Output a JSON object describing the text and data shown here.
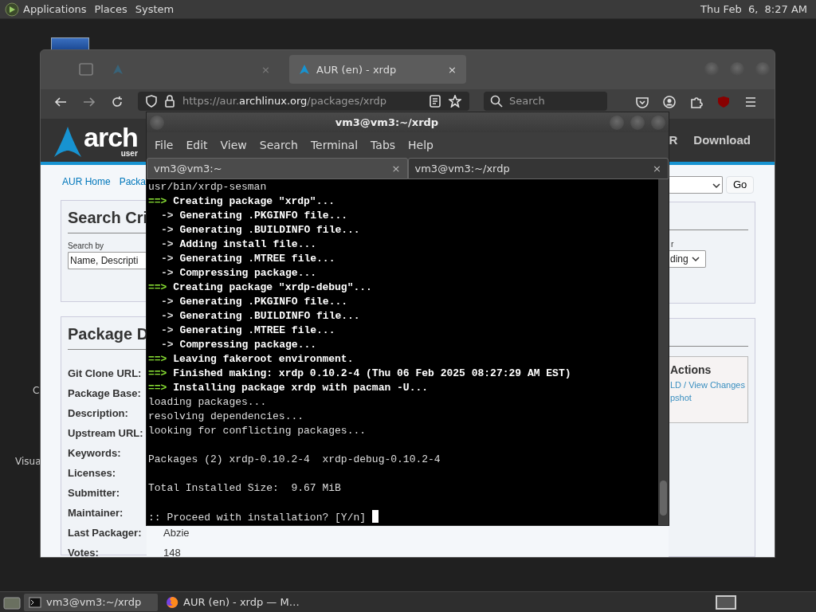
{
  "top_panel": {
    "menus": [
      "Applications",
      "Places",
      "System"
    ],
    "clock": "Thu Feb  6,  8:27 AM"
  },
  "desktop_icons": [
    {
      "label": "C"
    },
    {
      "label": "Visua"
    }
  ],
  "browser": {
    "tabs": [
      {
        "selected": false,
        "close": "×"
      },
      {
        "title": "AUR (en) - xrdp",
        "selected": true,
        "close": "×"
      }
    ],
    "url_parts": [
      "https://aur.",
      "archlinux.org",
      "/packages/xrdp"
    ],
    "search_placeholder": "Search",
    "site": {
      "logo": "arch",
      "logo_sub": "user",
      "nav": [
        "R",
        "Download"
      ],
      "breadcrumb": [
        "AUR Home",
        "Packa"
      ],
      "search_box": {
        "title": "Search Cri",
        "search_by_label": "Search by",
        "search_by_value": "Name, Descripti",
        "order_label": "r",
        "order_value": "ding",
        "go": "Go"
      },
      "details": {
        "title": "Package D",
        "fields": [
          {
            "label": "Git Clone URL:"
          },
          {
            "label": "Package Base:"
          },
          {
            "label": "Description:"
          },
          {
            "label": "Upstream URL:"
          },
          {
            "label": "Keywords:"
          },
          {
            "label": "Licenses:"
          },
          {
            "label": "Submitter:"
          },
          {
            "label": "Maintainer:"
          },
          {
            "label": "Last Packager:",
            "value": "Abzie"
          },
          {
            "label": "Votes:",
            "value": "148"
          }
        ],
        "actions_title": "Actions",
        "actions_links": [
          "LD / View Changes",
          "pshot"
        ]
      }
    }
  },
  "terminal": {
    "title": "vm3@vm3:~/xrdp",
    "menus": [
      "File",
      "Edit",
      "View",
      "Search",
      "Terminal",
      "Tabs",
      "Help"
    ],
    "tabs": [
      {
        "title": "vm3@vm3:~",
        "selected": false,
        "close": "×"
      },
      {
        "title": "vm3@vm3:~/xrdp",
        "selected": true,
        "close": "×"
      }
    ],
    "lines": [
      {
        "kind": "plain",
        "text": "usr/bin/xrdp-sesman"
      },
      {
        "kind": "main",
        "marker": "==>",
        "text": "Creating package \"xrdp\"..."
      },
      {
        "kind": "sub",
        "marker": "->",
        "text": "Generating .PKGINFO file..."
      },
      {
        "kind": "sub",
        "marker": "->",
        "text": "Generating .BUILDINFO file..."
      },
      {
        "kind": "sub",
        "marker": "->",
        "text": "Adding install file..."
      },
      {
        "kind": "sub",
        "marker": "->",
        "text": "Generating .MTREE file..."
      },
      {
        "kind": "sub",
        "marker": "->",
        "text": "Compressing package..."
      },
      {
        "kind": "main",
        "marker": "==>",
        "text": "Creating package \"xrdp-debug\"..."
      },
      {
        "kind": "sub",
        "marker": "->",
        "text": "Generating .PKGINFO file..."
      },
      {
        "kind": "sub",
        "marker": "->",
        "text": "Generating .BUILDINFO file..."
      },
      {
        "kind": "sub",
        "marker": "->",
        "text": "Generating .MTREE file..."
      },
      {
        "kind": "sub",
        "marker": "->",
        "text": "Compressing package..."
      },
      {
        "kind": "main",
        "marker": "==>",
        "text": "Leaving fakeroot environment."
      },
      {
        "kind": "main",
        "marker": "==>",
        "text": "Finished making: xrdp 0.10.2-4 (Thu 06 Feb 2025 08:27:29 AM EST)"
      },
      {
        "kind": "main",
        "marker": "==>",
        "text": "Installing package xrdp with pacman -U..."
      },
      {
        "kind": "plain",
        "text": "loading packages..."
      },
      {
        "kind": "plain",
        "text": "resolving dependencies..."
      },
      {
        "kind": "plain",
        "text": "looking for conflicting packages..."
      },
      {
        "kind": "blank"
      },
      {
        "kind": "plain",
        "text": "Packages (2) xrdp-0.10.2-4  xrdp-debug-0.10.2-4"
      },
      {
        "kind": "blank"
      },
      {
        "kind": "plain",
        "text": "Total Installed Size:  9.67 MiB"
      },
      {
        "kind": "blank"
      },
      {
        "kind": "prompt",
        "text": ":: Proceed with installation? [Y/n]"
      }
    ]
  },
  "taskbar": {
    "items": [
      {
        "kind": "terminal",
        "title": "vm3@vm3:~/xrdp",
        "selected": true
      },
      {
        "kind": "browser",
        "title": "AUR (en) - xrdp — M…",
        "selected": false
      }
    ]
  }
}
